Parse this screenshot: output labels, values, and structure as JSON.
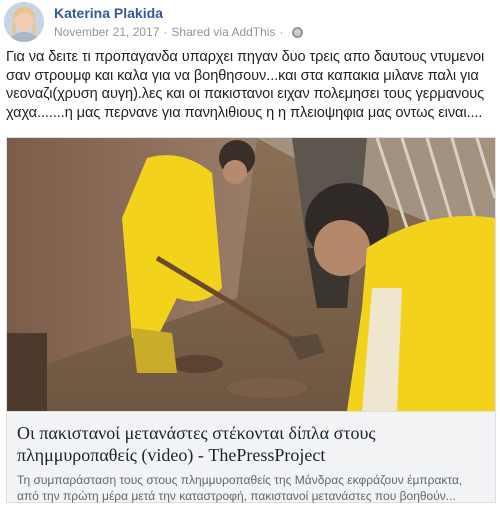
{
  "post": {
    "author": "Katerina Plakida",
    "date": "November 21, 2017",
    "separator": "·",
    "shared_via": "Shared via AddThis",
    "privacy_icon": "globe-icon",
    "text": "Για να δειτε τι προπαγανδα υπαρχει πηγαν δυο τρεις απο δαυτους ντυμενοι σαν στρουμφ και καλα για να βοηθησουν...και στα καπακια μιλανε παλι για νεοναζι(χρυση αυγη).λες και οι πακιστανοι ειχαν πολεμησει τους γερμανους χαχα.......η μας περνανε για πανηλιθιους η η πλειοψηφια μας οντως ειναι...."
  },
  "link_card": {
    "title": "Οι πακιστανοί μετανάστες στέκονται δίπλα στους πλημμυροπαθείς (video) - ThePressProject",
    "description": "Τη συμπαράσταση τους στους πλημμυροπαθείς της Μάνδρας εκφράζουν έμπρακτα, από την πρώτη μέρα μετά την καταστροφή, πακιστανοί μετανάστες που βοηθούν..."
  },
  "colors": {
    "author_link": "#365899",
    "meta_text": "#90949c",
    "body_text": "#1d2129",
    "card_bg": "#f2f3f5",
    "card_border": "#dddfe2",
    "raincoat_yellow": "#f2d21a"
  }
}
